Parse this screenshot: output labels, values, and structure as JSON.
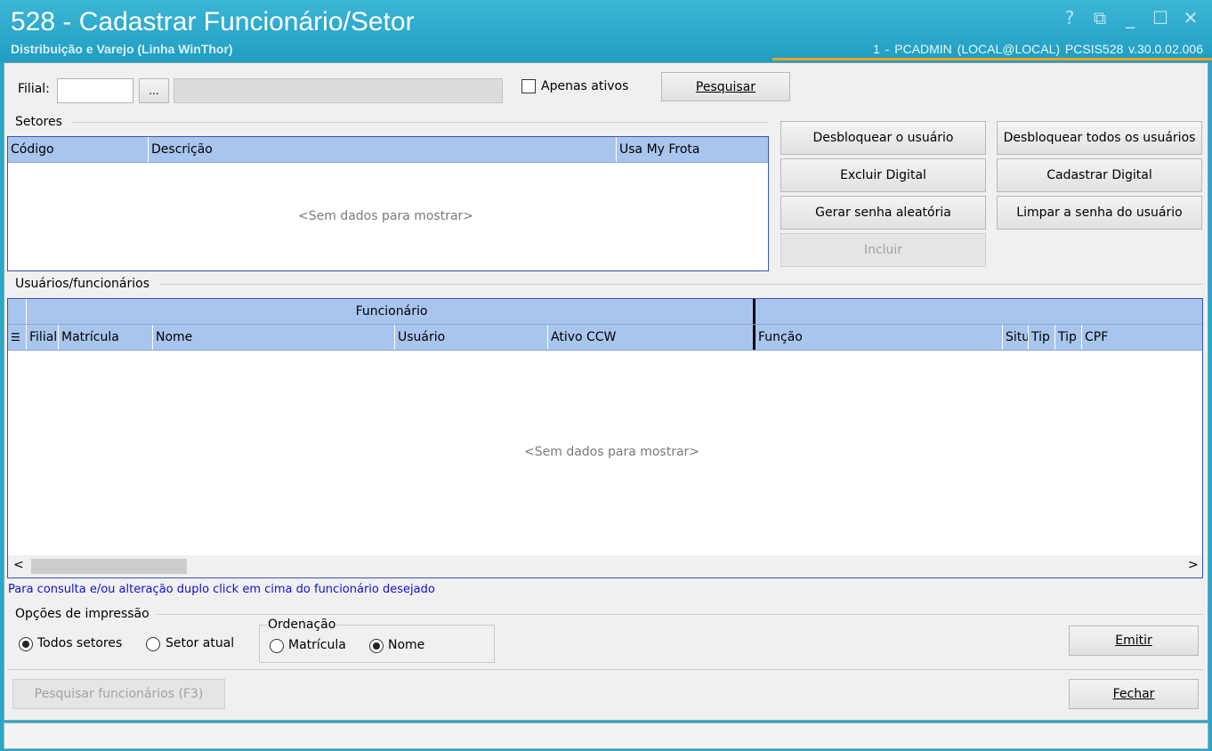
{
  "window": {
    "title": "528 - Cadastrar Funcionário/Setor",
    "subtitle": "Distribuição e Varejo (Linha WinThor)",
    "status": "1 - PCADMIN (LOCAL@LOCAL)  PCSIS528  v.30.0.02.006",
    "controls": {
      "help": "?",
      "restore": "⧉",
      "minimize": "_",
      "maximize": "☐",
      "close": "✕"
    }
  },
  "filter": {
    "filial_label": "Filial:",
    "filial_value": "",
    "lookup_label": "...",
    "filial_desc": "",
    "active_only_label": "Apenas ativos",
    "active_only_checked": false,
    "search_label": "Pesquisar"
  },
  "setores": {
    "group_label": "Setores",
    "columns": [
      "Código",
      "Descrição",
      "Usa My Frota"
    ],
    "empty": "<Sem dados para mostrar>"
  },
  "actions": {
    "desbloquear_usuario": "Desbloquear o usuário",
    "desbloquear_todos": "Desbloquear todos os usuários",
    "excluir_digital": "Excluir Digital",
    "cadastrar_digital": "Cadastrar Digital",
    "gerar_senha": "Gerar senha aleatória",
    "limpar_senha": "Limpar a senha do usuário",
    "incluir": "Incluir"
  },
  "usuarios": {
    "group_label": "Usuários/funcionários",
    "band_funcionario": "Funcionário",
    "columns": [
      "Filial",
      "Matrícula",
      "Nome",
      "Usuário",
      "Ativo CCW",
      "Função",
      "Situ",
      "Tip",
      "Tip",
      "CPF"
    ],
    "empty": "<Sem dados para mostrar>",
    "hint": "Para consulta e/ou alteração duplo click em cima do funcionário desejado"
  },
  "impressao": {
    "group_label": "Opções de impressão",
    "todos_setores": "Todos setores",
    "setor_atual": "Setor atual",
    "selected": "Todos setores"
  },
  "ordenacao": {
    "group_label": "Ordenação",
    "matricula": "Matrícula",
    "nome": "Nome",
    "selected": "Nome"
  },
  "footer": {
    "pesquisar_funcionarios": "Pesquisar funcionários (F3)",
    "emitir": "Emitir",
    "fechar": "Fechar"
  },
  "colors": {
    "titlebar": "#2aa7c7",
    "grid_header": "#a8c5ee",
    "grid_border": "#3857b3",
    "hint_text": "#1010d0",
    "accent_line": "#f0a020"
  }
}
